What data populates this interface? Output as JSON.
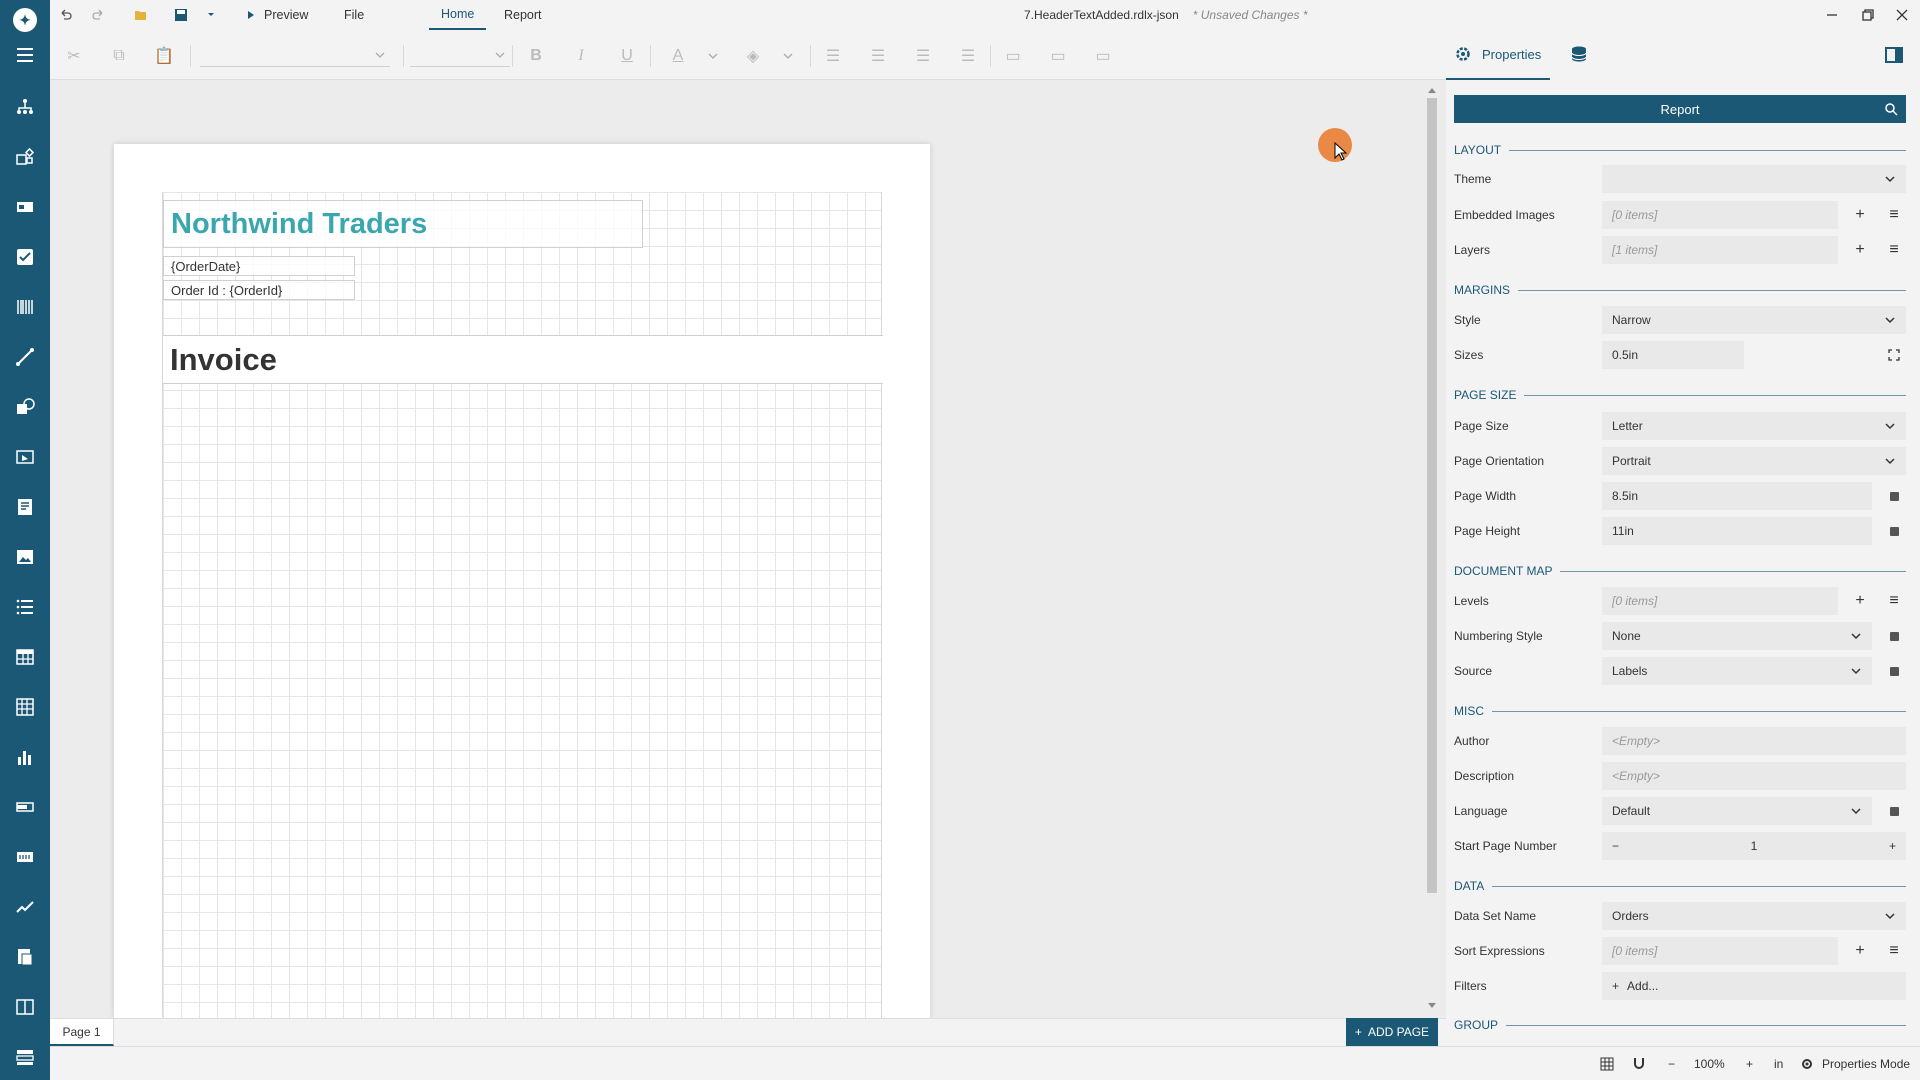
{
  "titlebar": {
    "preview": "Preview",
    "tabs": [
      "File",
      "Home",
      "Report"
    ],
    "active_tab": "Home",
    "document_name": "7.HeaderTextAdded.rdlx-json",
    "unsaved": "* Unsaved Changes *"
  },
  "report": {
    "company": "Northwind Traders",
    "order_date": "{OrderDate}",
    "order_id": "Order Id : {OrderId}",
    "invoice": "Invoice"
  },
  "pages": {
    "tab": "Page 1",
    "add_page": "ADD PAGE"
  },
  "status": {
    "zoom": "100%",
    "unit": "in",
    "mode": "Properties Mode"
  },
  "panel": {
    "tab_label": "Properties",
    "report_title": "Report",
    "sections": {
      "layout": "LAYOUT",
      "margins": "MARGINS",
      "page_size": "PAGE SIZE",
      "document_map": "DOCUMENT MAP",
      "misc": "MISC",
      "data": "DATA",
      "group": "GROUP"
    },
    "props": {
      "theme": {
        "label": "Theme",
        "value": ""
      },
      "embedded_images": {
        "label": "Embedded Images",
        "value": "[0 items]"
      },
      "layers": {
        "label": "Layers",
        "value": "[1 items]"
      },
      "style": {
        "label": "Style",
        "value": "Narrow"
      },
      "sizes": {
        "label": "Sizes",
        "value": "0.5in"
      },
      "page_size": {
        "label": "Page Size",
        "value": "Letter"
      },
      "page_orientation": {
        "label": "Page Orientation",
        "value": "Portrait"
      },
      "page_width": {
        "label": "Page Width",
        "value": "8.5in"
      },
      "page_height": {
        "label": "Page Height",
        "value": "11in"
      },
      "levels": {
        "label": "Levels",
        "value": "[0 items]"
      },
      "numbering_style": {
        "label": "Numbering Style",
        "value": "None"
      },
      "source": {
        "label": "Source",
        "value": "Labels"
      },
      "author": {
        "label": "Author",
        "value": "<Empty>"
      },
      "description": {
        "label": "Description",
        "value": "<Empty>"
      },
      "language": {
        "label": "Language",
        "value": "Default"
      },
      "start_page_number": {
        "label": "Start Page Number",
        "value": "1"
      },
      "data_set_name": {
        "label": "Data Set Name",
        "value": "Orders"
      },
      "sort_expressions": {
        "label": "Sort Expressions",
        "value": "[0 items]"
      },
      "filters": {
        "label": "Filters",
        "value": "Add..."
      }
    }
  }
}
